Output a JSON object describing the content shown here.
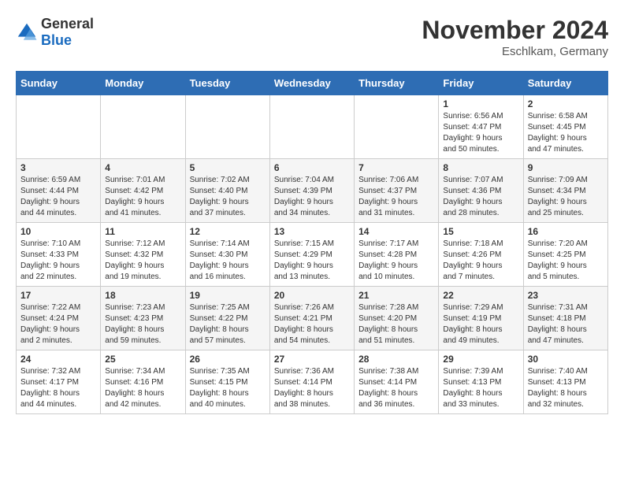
{
  "header": {
    "logo_general": "General",
    "logo_blue": "Blue",
    "title": "November 2024",
    "location": "Eschlkam, Germany"
  },
  "weekdays": [
    "Sunday",
    "Monday",
    "Tuesday",
    "Wednesday",
    "Thursday",
    "Friday",
    "Saturday"
  ],
  "weeks": [
    [
      {
        "day": "",
        "info": ""
      },
      {
        "day": "",
        "info": ""
      },
      {
        "day": "",
        "info": ""
      },
      {
        "day": "",
        "info": ""
      },
      {
        "day": "",
        "info": ""
      },
      {
        "day": "1",
        "info": "Sunrise: 6:56 AM\nSunset: 4:47 PM\nDaylight: 9 hours\nand 50 minutes."
      },
      {
        "day": "2",
        "info": "Sunrise: 6:58 AM\nSunset: 4:45 PM\nDaylight: 9 hours\nand 47 minutes."
      }
    ],
    [
      {
        "day": "3",
        "info": "Sunrise: 6:59 AM\nSunset: 4:44 PM\nDaylight: 9 hours\nand 44 minutes."
      },
      {
        "day": "4",
        "info": "Sunrise: 7:01 AM\nSunset: 4:42 PM\nDaylight: 9 hours\nand 41 minutes."
      },
      {
        "day": "5",
        "info": "Sunrise: 7:02 AM\nSunset: 4:40 PM\nDaylight: 9 hours\nand 37 minutes."
      },
      {
        "day": "6",
        "info": "Sunrise: 7:04 AM\nSunset: 4:39 PM\nDaylight: 9 hours\nand 34 minutes."
      },
      {
        "day": "7",
        "info": "Sunrise: 7:06 AM\nSunset: 4:37 PM\nDaylight: 9 hours\nand 31 minutes."
      },
      {
        "day": "8",
        "info": "Sunrise: 7:07 AM\nSunset: 4:36 PM\nDaylight: 9 hours\nand 28 minutes."
      },
      {
        "day": "9",
        "info": "Sunrise: 7:09 AM\nSunset: 4:34 PM\nDaylight: 9 hours\nand 25 minutes."
      }
    ],
    [
      {
        "day": "10",
        "info": "Sunrise: 7:10 AM\nSunset: 4:33 PM\nDaylight: 9 hours\nand 22 minutes."
      },
      {
        "day": "11",
        "info": "Sunrise: 7:12 AM\nSunset: 4:32 PM\nDaylight: 9 hours\nand 19 minutes."
      },
      {
        "day": "12",
        "info": "Sunrise: 7:14 AM\nSunset: 4:30 PM\nDaylight: 9 hours\nand 16 minutes."
      },
      {
        "day": "13",
        "info": "Sunrise: 7:15 AM\nSunset: 4:29 PM\nDaylight: 9 hours\nand 13 minutes."
      },
      {
        "day": "14",
        "info": "Sunrise: 7:17 AM\nSunset: 4:28 PM\nDaylight: 9 hours\nand 10 minutes."
      },
      {
        "day": "15",
        "info": "Sunrise: 7:18 AM\nSunset: 4:26 PM\nDaylight: 9 hours\nand 7 minutes."
      },
      {
        "day": "16",
        "info": "Sunrise: 7:20 AM\nSunset: 4:25 PM\nDaylight: 9 hours\nand 5 minutes."
      }
    ],
    [
      {
        "day": "17",
        "info": "Sunrise: 7:22 AM\nSunset: 4:24 PM\nDaylight: 9 hours\nand 2 minutes."
      },
      {
        "day": "18",
        "info": "Sunrise: 7:23 AM\nSunset: 4:23 PM\nDaylight: 8 hours\nand 59 minutes."
      },
      {
        "day": "19",
        "info": "Sunrise: 7:25 AM\nSunset: 4:22 PM\nDaylight: 8 hours\nand 57 minutes."
      },
      {
        "day": "20",
        "info": "Sunrise: 7:26 AM\nSunset: 4:21 PM\nDaylight: 8 hours\nand 54 minutes."
      },
      {
        "day": "21",
        "info": "Sunrise: 7:28 AM\nSunset: 4:20 PM\nDaylight: 8 hours\nand 51 minutes."
      },
      {
        "day": "22",
        "info": "Sunrise: 7:29 AM\nSunset: 4:19 PM\nDaylight: 8 hours\nand 49 minutes."
      },
      {
        "day": "23",
        "info": "Sunrise: 7:31 AM\nSunset: 4:18 PM\nDaylight: 8 hours\nand 47 minutes."
      }
    ],
    [
      {
        "day": "24",
        "info": "Sunrise: 7:32 AM\nSunset: 4:17 PM\nDaylight: 8 hours\nand 44 minutes."
      },
      {
        "day": "25",
        "info": "Sunrise: 7:34 AM\nSunset: 4:16 PM\nDaylight: 8 hours\nand 42 minutes."
      },
      {
        "day": "26",
        "info": "Sunrise: 7:35 AM\nSunset: 4:15 PM\nDaylight: 8 hours\nand 40 minutes."
      },
      {
        "day": "27",
        "info": "Sunrise: 7:36 AM\nSunset: 4:14 PM\nDaylight: 8 hours\nand 38 minutes."
      },
      {
        "day": "28",
        "info": "Sunrise: 7:38 AM\nSunset: 4:14 PM\nDaylight: 8 hours\nand 36 minutes."
      },
      {
        "day": "29",
        "info": "Sunrise: 7:39 AM\nSunset: 4:13 PM\nDaylight: 8 hours\nand 33 minutes."
      },
      {
        "day": "30",
        "info": "Sunrise: 7:40 AM\nSunset: 4:13 PM\nDaylight: 8 hours\nand 32 minutes."
      }
    ]
  ]
}
